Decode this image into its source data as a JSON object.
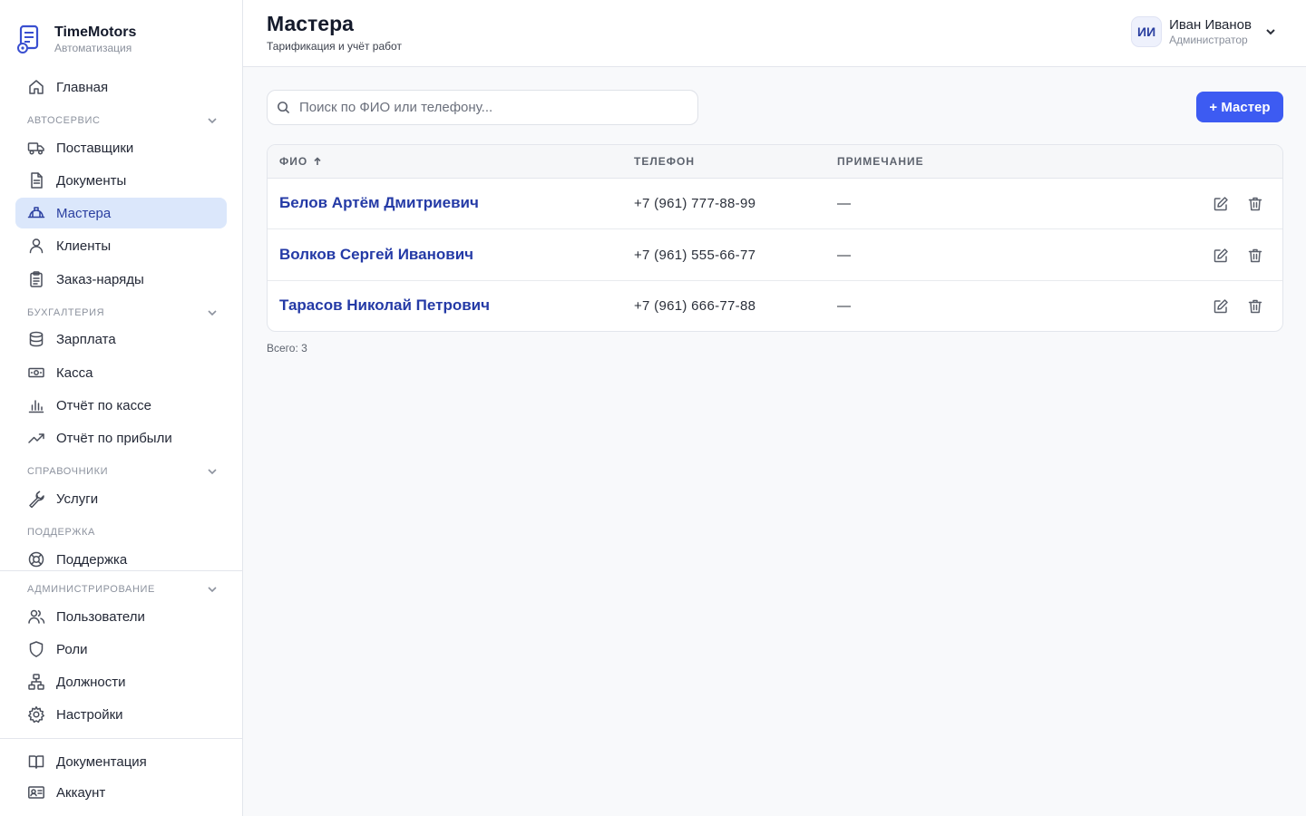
{
  "brand": {
    "name": "TimeMotors",
    "subtitle": "Автоматизация"
  },
  "sidebar": {
    "home": "Главная",
    "groups": {
      "autoservice": "Автосервис",
      "accounting": "Бухгалтерия",
      "references": "Справочники",
      "support": "Поддержка",
      "administration": "Администрирование"
    },
    "items": {
      "suppliers": "Поставщики",
      "documents": "Документы",
      "masters": "Мастера",
      "clients": "Клиенты",
      "orders": "Заказ-наряды",
      "salary": "Зарплата",
      "cashbox": "Касса",
      "cash_report": "Отчёт по кассе",
      "profit_report": "Отчёт по прибыли",
      "services": "Услуги",
      "support": "Поддержка",
      "users": "Пользователи",
      "roles": "Роли",
      "positions": "Должности",
      "settings": "Настройки",
      "documentation": "Документация",
      "account": "Аккаунт"
    },
    "active": "masters"
  },
  "header": {
    "title": "Мастера",
    "subtitle": "Тарификация и учёт работ",
    "user": {
      "initials": "ИИ",
      "name": "Иван Иванов",
      "role": "Администратор"
    }
  },
  "search": {
    "placeholder": "Поиск по ФИО или телефону...",
    "value": ""
  },
  "add_button": "+ Мастер",
  "table": {
    "columns": {
      "name": "ФИО",
      "phone": "ТЕЛЕФОН",
      "note": "ПРИМЕЧАНИЕ"
    },
    "sort": {
      "column": "name",
      "direction": "asc"
    },
    "rows": [
      {
        "name": "Белов Артём Дмитриевич",
        "phone": "+7 (961) 777-88-99",
        "note": "—"
      },
      {
        "name": "Волков Сергей Иванович",
        "phone": "+7 (961) 555-66-77",
        "note": "—"
      },
      {
        "name": "Тарасов Николай Петрович",
        "phone": "+7 (961) 666-77-88",
        "note": "—"
      }
    ]
  },
  "total": "Всего: 3",
  "colors": {
    "accent": "#3d5bf2",
    "link": "#243aa6",
    "active_bg": "#dbe7fb"
  }
}
